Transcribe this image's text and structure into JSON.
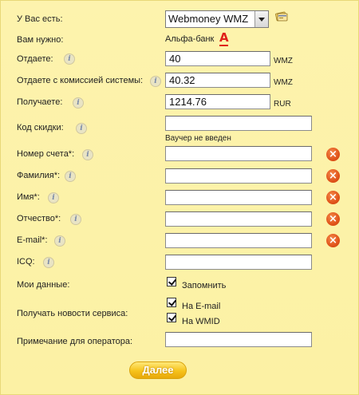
{
  "form": {
    "have_label": "У Вас есть:",
    "have_value": "Webmoney WMZ",
    "need_label": "Вам нужно:",
    "need_value": "Альфа-банк",
    "bank_logo": "А",
    "give_label": "Отдаете:",
    "give_value": "40",
    "give_unit": "WMZ",
    "give_fee_label": "Отдаете с комиссией системы:",
    "give_fee_value": "40.32",
    "give_fee_unit": "WMZ",
    "receive_label": "Получаете:",
    "receive_value": "1214.76",
    "receive_unit": "RUR",
    "discount_label": "Код скидки:",
    "discount_value": "",
    "voucher_note": "Ваучер не введен",
    "account_label": "Номер счета*:",
    "lastname_label": "Фамилия*:",
    "firstname_label": "Имя*:",
    "patronymic_label": "Отчество*:",
    "email_label": "E-mail*:",
    "icq_label": "ICQ:",
    "mydata_label": "Мои данные:",
    "remember_label": "Запомнить",
    "news_label": "Получать новости сервиса:",
    "news_email_label": "На E-mail",
    "news_wmid_label": "На WMID",
    "note_label": "Примечание для оператора:",
    "submit_label": "Далее",
    "info_glyph": "i",
    "error_glyph": "×"
  },
  "colors": {
    "background": "#fdf3a8",
    "error": "#e0531a",
    "button": "#f6c21a",
    "bank_logo": "#e0201b"
  },
  "icons": [
    "info-icon",
    "error-icon",
    "card-icon",
    "alfa-bank-logo",
    "checkbox-checked"
  ]
}
